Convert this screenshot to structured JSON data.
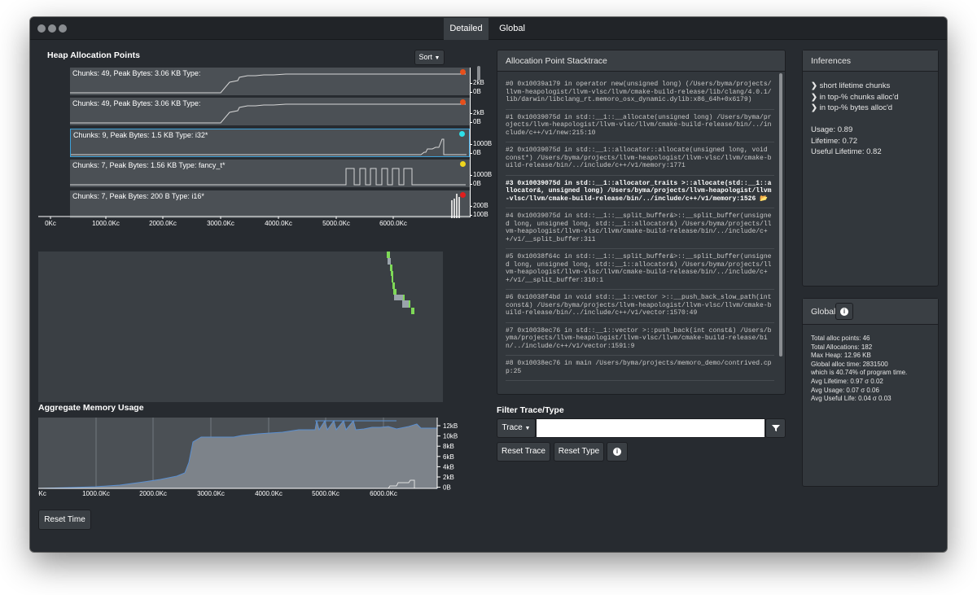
{
  "tabs": [
    {
      "label": "Detailed",
      "active": true
    },
    {
      "label": "Global",
      "active": false
    }
  ],
  "heap": {
    "title": "Heap Allocation Points",
    "sort_label": "Sort",
    "rows": [
      {
        "label": "Chunks: 49, Peak Bytes: 3.06 KB Type:",
        "color": "#e8501c",
        "ticks": [
          "2kB",
          "0B"
        ],
        "shape": "rise"
      },
      {
        "label": "Chunks: 49, Peak Bytes: 3.06 KB Type:",
        "color": "#e8501c",
        "ticks": [
          "2kB",
          "0B"
        ],
        "shape": "rise"
      },
      {
        "label": "Chunks: 9, Peak Bytes: 1.5 KB Type: i32*",
        "color": "#2ee0e8",
        "ticks": [
          "1000B",
          "0B"
        ],
        "shape": "steps"
      },
      {
        "label": "Chunks: 7, Peak Bytes: 1.56 KB Type: fancy_t*",
        "color": "#f0d61e",
        "ticks": [
          "1000B",
          "0B"
        ],
        "shape": "pulses"
      },
      {
        "label": "Chunks: 7, Peak Bytes: 200 B Type: i16*",
        "color": "#e01e1e",
        "ticks": [
          "200B",
          "100B"
        ],
        "shape": "bars"
      }
    ],
    "x_ticks": [
      "0Kc",
      "1000.0Kc",
      "2000.0Kc",
      "3000.0Kc",
      "4000.0Kc",
      "5000.0Kc",
      "6000.0Kc"
    ]
  },
  "aggregate": {
    "title": "Aggregate Memory Usage",
    "y_ticks": [
      "12kB",
      "10kB",
      "8kB",
      "6kB",
      "4kB",
      "2kB",
      "0B"
    ],
    "x_ticks": [
      "0Kc",
      "1000.0Kc",
      "2000.0Kc",
      "3000.0Kc",
      "4000.0Kc",
      "5000.0Kc",
      "6000.0Kc"
    ],
    "reset_label": "Reset Time"
  },
  "stacktrace": {
    "title": "Allocation Point Stacktrace",
    "entries": [
      {
        "text": "#0 0x10039a179 in operator new(unsigned long) (/Users/byma/projects/llvm-heapologist/llvm-vlsc/llvm/cmake-build-release/lib/clang/4.0.1/lib/darwin/libclang_rt.memoro_osx_dynamic.dylib:x86_64h+0x6179)",
        "bold": false
      },
      {
        "text": "#1 0x10039075d in std::__1::__allocate(unsigned long) /Users/byma/projects/llvm-heapologist/llvm-vlsc/llvm/cmake-build-release/bin/../include/c++/v1/new:215:10",
        "bold": false
      },
      {
        "text": "#2 0x10039075d in std::__1::allocator::allocate(unsigned long, void const*) /Users/byma/projects/llvm-heapologist/llvm-vlsc/llvm/cmake-build-release/bin/../include/c++/v1/memory:1771",
        "bold": false
      },
      {
        "text": "#3 0x10039075d in std::__1::allocator_traits >::allocate(std::__1::allocator&, unsigned long) /Users/byma/projects/llvm-heapologist/llvm-vlsc/llvm/cmake-build-release/bin/../include/c++/v1/memory:1526 📂",
        "bold": true
      },
      {
        "text": "#4 0x10039075d in std::__1::__split_buffer&>::__split_buffer(unsigned long, unsigned long, std::__1::allocator&) /Users/byma/projects/llvm-heapologist/llvm-vlsc/llvm/cmake-build-release/bin/../include/c++/v1/__split_buffer:311",
        "bold": false
      },
      {
        "text": "#5 0x10038f64c in std::__1::__split_buffer&>::__split_buffer(unsigned long, unsigned long, std::__1::allocator&) /Users/byma/projects/llvm-heapologist/llvm-vlsc/llvm/cmake-build-release/bin/../include/c++/v1/__split_buffer:310:1",
        "bold": false
      },
      {
        "text": "#6 0x10038f4bd in void std::__1::vector >::__push_back_slow_path(int const&) /Users/byma/projects/llvm-heapologist/llvm-vlsc/llvm/cmake-build-release/bin/../include/c++/v1/vector:1570:49",
        "bold": false
      },
      {
        "text": "#7 0x10038ec76 in std::__1::vector >::push_back(int const&) /Users/byma/projects/llvm-heapologist/llvm-vlsc/llvm/cmake-build-release/bin/../include/c++/v1/vector:1591:9",
        "bold": false
      },
      {
        "text": "#8 0x10038ec76 in main /Users/byma/projects/memoro_demo/contrived.cpp:25",
        "bold": false
      }
    ]
  },
  "filter": {
    "title": "Filter Trace/Type",
    "dropdown_label": "Trace",
    "input_value": "",
    "reset_trace_label": "Reset Trace",
    "reset_type_label": "Reset Type"
  },
  "inferences": {
    "title": "Inferences",
    "items": [
      "short lifetime chunks",
      "in top-% chunks alloc'd",
      "in top-% bytes alloc'd"
    ],
    "stats": [
      "Usage: 0.89",
      "Lifetime: 0.72",
      "Useful Lifetime: 0.82"
    ]
  },
  "global": {
    "title": "Global",
    "stats": [
      "Total alloc points: 46",
      "Total Allocations: 182",
      "Max Heap: 12.96 KB",
      "Global alloc time: 2831500",
      "which is 40.74% of program time.",
      "Avg Lifetime: 0.97 σ 0.02",
      "Avg Usage: 0.07 σ 0.06",
      "Avg Useful Life: 0.04 σ 0.03"
    ]
  }
}
